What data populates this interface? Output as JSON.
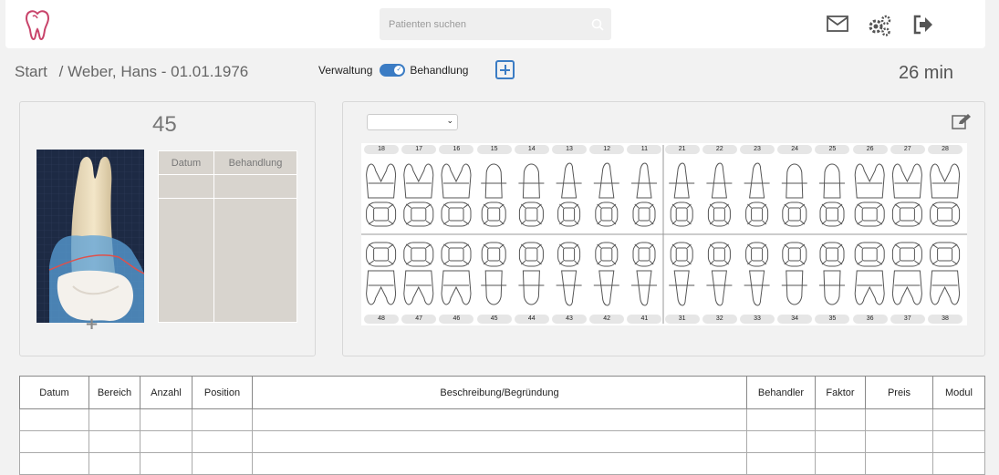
{
  "header": {
    "search_placeholder": "Patienten suchen",
    "icons": [
      "tooth-logo-icon",
      "mail-icon",
      "settings-gears-icon",
      "logout-icon",
      "search-icon"
    ]
  },
  "breadcrumb": {
    "start": "Start",
    "patient": "/ Weber, Hans - 01.01.1976"
  },
  "mode": {
    "left": "Verwaltung",
    "right": "Behandlung",
    "active": "Behandlung"
  },
  "timer": "26 min",
  "tooth_panel": {
    "tooth_number": "45",
    "columns": [
      "Datum",
      "Behandlung"
    ]
  },
  "chart": {
    "select_value": "",
    "upper": [
      "18",
      "17",
      "16",
      "15",
      "14",
      "13",
      "12",
      "11",
      "21",
      "22",
      "23",
      "24",
      "25",
      "26",
      "27",
      "28"
    ],
    "lower": [
      "48",
      "47",
      "46",
      "45",
      "44",
      "43",
      "42",
      "41",
      "31",
      "32",
      "33",
      "34",
      "35",
      "36",
      "37",
      "38"
    ]
  },
  "table": {
    "columns": [
      "Datum",
      "Bereich",
      "Anzahl",
      "Position",
      "Beschreibung/Begründung",
      "Behandler",
      "Faktor",
      "Preis",
      "Modul"
    ],
    "rows": 3
  },
  "colors": {
    "accent": "#3b7cc4",
    "brand": "#c8436a"
  }
}
